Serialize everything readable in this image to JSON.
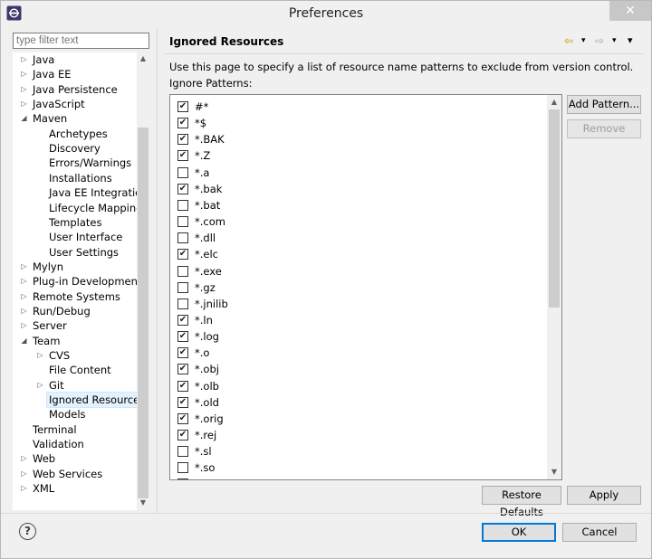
{
  "window": {
    "title": "Preferences",
    "close_glyph": "✕"
  },
  "filter": {
    "placeholder": "type filter text"
  },
  "tree": [
    {
      "label": "Java",
      "twisty": "▷",
      "level": 0
    },
    {
      "label": "Java EE",
      "twisty": "▷",
      "level": 0
    },
    {
      "label": "Java Persistence",
      "twisty": "▷",
      "level": 0
    },
    {
      "label": "JavaScript",
      "twisty": "▷",
      "level": 0
    },
    {
      "label": "Maven",
      "twisty": "◢",
      "level": 0
    },
    {
      "label": "Archetypes",
      "twisty": "",
      "level": 1
    },
    {
      "label": "Discovery",
      "twisty": "",
      "level": 1
    },
    {
      "label": "Errors/Warnings",
      "twisty": "",
      "level": 1
    },
    {
      "label": "Installations",
      "twisty": "",
      "level": 1
    },
    {
      "label": "Java EE Integration",
      "twisty": "",
      "level": 1
    },
    {
      "label": "Lifecycle Mappings",
      "twisty": "",
      "level": 1
    },
    {
      "label": "Templates",
      "twisty": "",
      "level": 1
    },
    {
      "label": "User Interface",
      "twisty": "",
      "level": 1
    },
    {
      "label": "User Settings",
      "twisty": "",
      "level": 1
    },
    {
      "label": "Mylyn",
      "twisty": "▷",
      "level": 0
    },
    {
      "label": "Plug-in Development",
      "twisty": "▷",
      "level": 0
    },
    {
      "label": "Remote Systems",
      "twisty": "▷",
      "level": 0
    },
    {
      "label": "Run/Debug",
      "twisty": "▷",
      "level": 0
    },
    {
      "label": "Server",
      "twisty": "▷",
      "level": 0
    },
    {
      "label": "Team",
      "twisty": "◢",
      "level": 0
    },
    {
      "label": "CVS",
      "twisty": "▷",
      "level": 1
    },
    {
      "label": "File Content",
      "twisty": "",
      "level": 1
    },
    {
      "label": "Git",
      "twisty": "▷",
      "level": 1
    },
    {
      "label": "Ignored Resources",
      "twisty": "",
      "level": 1,
      "selected": true
    },
    {
      "label": "Models",
      "twisty": "",
      "level": 1
    },
    {
      "label": "Terminal",
      "twisty": "",
      "level": 0
    },
    {
      "label": "Validation",
      "twisty": "",
      "level": 0
    },
    {
      "label": "Web",
      "twisty": "▷",
      "level": 0
    },
    {
      "label": "Web Services",
      "twisty": "▷",
      "level": 0
    },
    {
      "label": "XML",
      "twisty": "▷",
      "level": 0
    }
  ],
  "page": {
    "title": "Ignored Resources",
    "description": "Use this page to specify a list of resource name patterns to exclude from version control.",
    "patterns_label": "Ignore Patterns:",
    "nav": {
      "back": "⇦",
      "menu": "▾",
      "forward": "⇨"
    }
  },
  "patterns": [
    {
      "name": "#*",
      "checked": true
    },
    {
      "name": "*$",
      "checked": true
    },
    {
      "name": "*.BAK",
      "checked": true
    },
    {
      "name": "*.Z",
      "checked": true
    },
    {
      "name": "*.a",
      "checked": false
    },
    {
      "name": "*.bak",
      "checked": true
    },
    {
      "name": "*.bat",
      "checked": false
    },
    {
      "name": "*.com",
      "checked": false
    },
    {
      "name": "*.dll",
      "checked": false
    },
    {
      "name": "*.elc",
      "checked": true
    },
    {
      "name": "*.exe",
      "checked": false
    },
    {
      "name": "*.gz",
      "checked": false
    },
    {
      "name": "*.jnilib",
      "checked": false
    },
    {
      "name": "*.ln",
      "checked": true
    },
    {
      "name": "*.log",
      "checked": true
    },
    {
      "name": "*.o",
      "checked": true
    },
    {
      "name": "*.obj",
      "checked": true
    },
    {
      "name": "*.olb",
      "checked": true
    },
    {
      "name": "*.old",
      "checked": true
    },
    {
      "name": "*.orig",
      "checked": true
    },
    {
      "name": "*.rej",
      "checked": true
    },
    {
      "name": "*.sl",
      "checked": false
    },
    {
      "name": "*.so",
      "checked": false
    },
    {
      "name": "*.zip",
      "checked": false
    }
  ],
  "buttons": {
    "add_pattern": "Add Pattern...",
    "remove": "Remove",
    "restore_defaults": "Restore Defaults",
    "apply": "Apply",
    "ok": "OK",
    "cancel": "Cancel",
    "help": "?"
  },
  "glyphs": {
    "check": "✔",
    "arrow_up": "▲",
    "arrow_down": "▼"
  }
}
